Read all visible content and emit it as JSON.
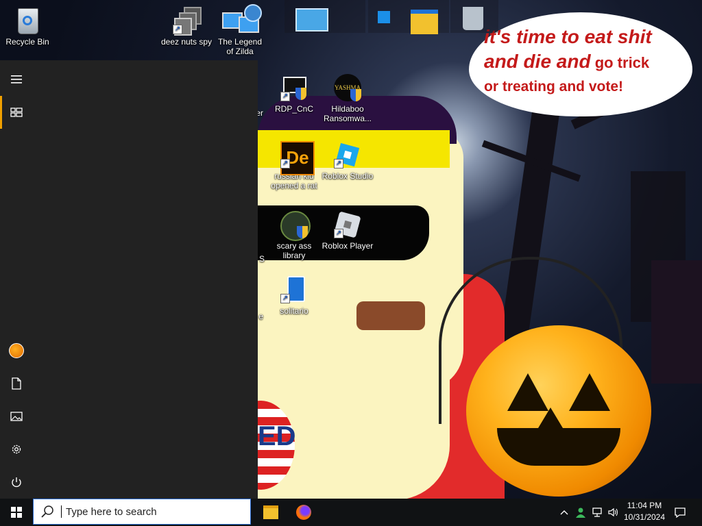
{
  "desktop": {
    "icons": [
      {
        "id": "recycle-bin",
        "label": "Recycle Bin"
      },
      {
        "id": "deez-nuts-spy",
        "label": "deez nuts spy"
      },
      {
        "id": "legend-of-zilda",
        "label": "The Legend of Zilda"
      },
      {
        "id": "rdp-cnc",
        "label": "RDP_CnC"
      },
      {
        "id": "hildaboo",
        "label": "Hildaboo Ransomwa..."
      },
      {
        "id": "russian-kid",
        "label": "russian kid opened a rat"
      },
      {
        "id": "roblox-studio",
        "label": "Roblox Studio"
      },
      {
        "id": "scary-ass-library",
        "label": "scary ass library"
      },
      {
        "id": "roblox-player",
        "label": "Roblox Player"
      },
      {
        "id": "solitario",
        "label": "solitario"
      }
    ],
    "partial_labels": {
      "a": "er",
      "b": "S",
      "c": "e"
    },
    "hildaboo_logo": "YASHMA",
    "wallpaper": {
      "speech_line1": "it's time to eat shit",
      "speech_line2a": "and die and",
      "speech_line2b": " go trick",
      "speech_line3": "or treating and vote!",
      "badge_text": "ED"
    }
  },
  "start_menu": {
    "rail": [
      {
        "id": "hamburger",
        "icon": "hamburger-icon"
      },
      {
        "id": "tiles",
        "icon": "tiles-icon"
      },
      {
        "id": "user",
        "icon": "user-avatar"
      },
      {
        "id": "documents",
        "icon": "document-icon"
      },
      {
        "id": "pictures",
        "icon": "pictures-icon"
      },
      {
        "id": "settings",
        "icon": "gear-icon"
      },
      {
        "id": "power",
        "icon": "power-icon"
      }
    ]
  },
  "taskbar": {
    "search_placeholder": "Type here to search",
    "apps": [
      {
        "id": "file-explorer",
        "icon": "folder-icon"
      },
      {
        "id": "firefox",
        "icon": "firefox-icon"
      }
    ],
    "tray_icons": [
      "chevron-up-icon",
      "people-icon",
      "network-icon",
      "volume-icon"
    ],
    "time": "11:04 PM",
    "date": "10/31/2024",
    "notification_icon": "notification-icon"
  },
  "colors": {
    "start_menu_bg": "#222222",
    "taskbar_bg": "#101214",
    "accent": "#f0a000",
    "search_border": "#2a6cd6"
  }
}
